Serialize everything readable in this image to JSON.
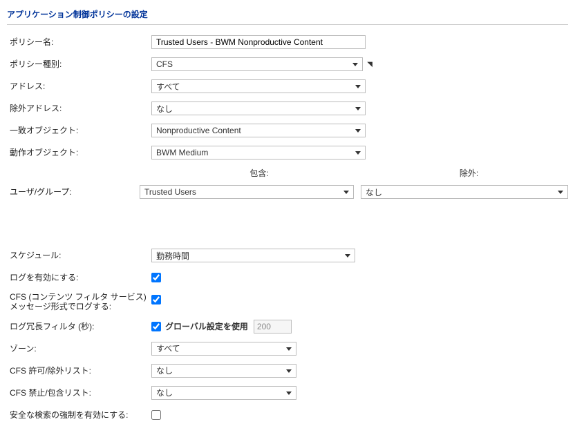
{
  "title": "アプリケーション制御ポリシーの設定",
  "fields": {
    "policyName": {
      "label": "ポリシー名:",
      "value": "Trusted Users - BWM Nonproductive Content"
    },
    "policyType": {
      "label": "ポリシー種別:",
      "value": "CFS"
    },
    "address": {
      "label": "アドレス:",
      "value": "すべて"
    },
    "exclAddr": {
      "label": "除外アドレス:",
      "value": "なし"
    },
    "matchObj": {
      "label": "一致オブジェクト:",
      "value": "Nonproductive Content"
    },
    "actionObj": {
      "label": "動作オブジェクト:",
      "value": "BWM Medium"
    },
    "userGroup": {
      "label": "ユーザ/グループ:",
      "include": "Trusted Users",
      "exclude": "なし"
    },
    "schedule": {
      "label": "スケジュール:",
      "value": "勤務時間"
    },
    "enableLog": {
      "label": "ログを有効にする:",
      "checked": true
    },
    "cfsMsgLog": {
      "label": "CFS (コンテンツ フィルタ サービス) メッセージ形式でログする:",
      "checked": true
    },
    "redundancy": {
      "label": "ログ冗長フィルタ (秒):",
      "checked": true,
      "useGlobal": "グローバル設定を使用",
      "value": "200"
    },
    "zone": {
      "label": "ゾーン:",
      "value": "すべて"
    },
    "cfsAllow": {
      "label": "CFS 許可/除外リスト:",
      "value": "なし"
    },
    "cfsDeny": {
      "label": "CFS 禁止/包含リスト:",
      "value": "なし"
    },
    "safeSearch": {
      "label": "安全な検索の強制を有効にする:",
      "checked": false
    }
  },
  "headers": {
    "include": "包含:",
    "exclude": "除外:"
  }
}
